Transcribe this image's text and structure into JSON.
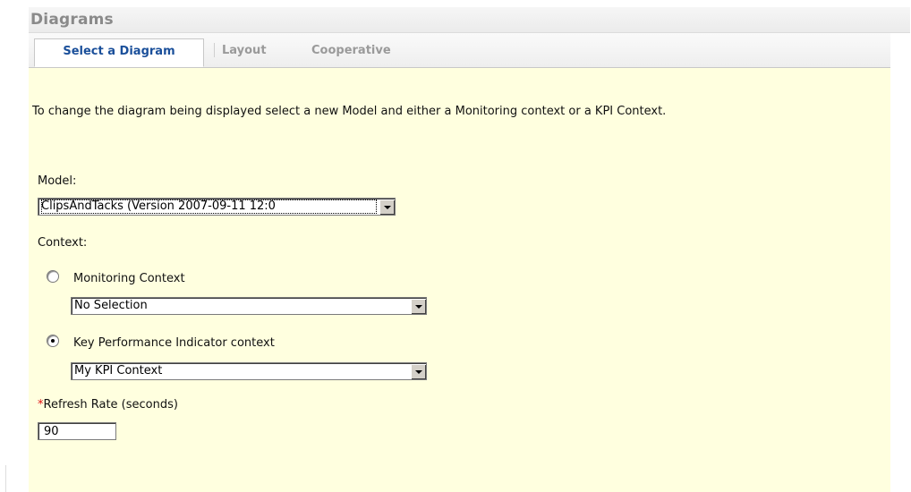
{
  "portlet": {
    "title": "Diagrams"
  },
  "tabs": [
    {
      "label": "Select a Diagram",
      "active": true
    },
    {
      "label": "Layout",
      "active": false
    },
    {
      "label": "Cooperative",
      "active": false
    }
  ],
  "content": {
    "intro": "To change the diagram being displayed select a new Model and either a Monitoring context or a KPI Context.",
    "model": {
      "label": "Model:",
      "selected": "ClipsAndTacks (Version 2007-09-11 12:0"
    },
    "context": {
      "label": "Context:",
      "monitoring": {
        "label": "Monitoring Context",
        "checked": false,
        "selected": "No Selection"
      },
      "kpi": {
        "label": "Key Performance Indicator context",
        "checked": true,
        "selected": "My KPI Context"
      }
    },
    "refresh": {
      "required_marker": "*",
      "label": "Refresh Rate (seconds)",
      "value": "90"
    }
  },
  "colors": {
    "panel_background": "#ffffdf",
    "active_tab_text": "#1a4f9a",
    "inactive_tab_text": "#9a9a9a",
    "required_marker": "#e01010"
  },
  "icons": {
    "dropdown": "chevron-down-icon"
  }
}
